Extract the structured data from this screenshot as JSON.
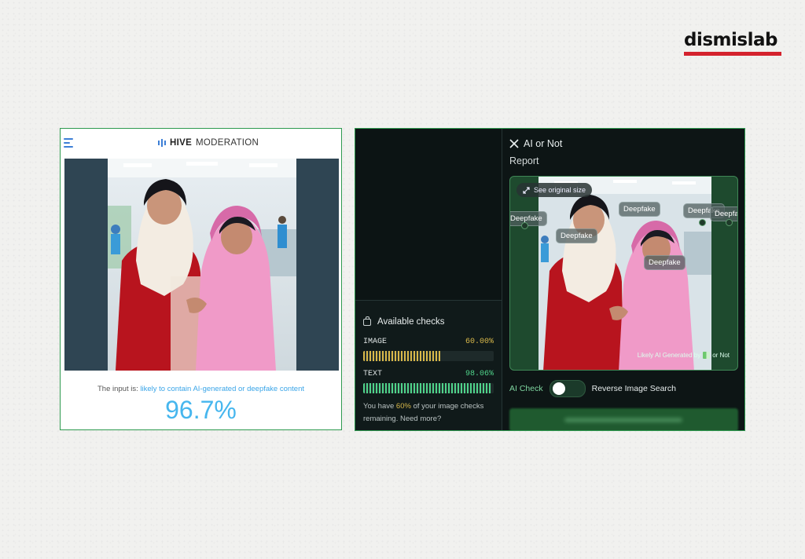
{
  "brand": {
    "name": "dismislab"
  },
  "hive": {
    "logo_bold": "HIVE",
    "logo_rest": "MODERATION",
    "result_prefix": "The input is:",
    "result_highlight": "likely to contain AI-generated or deepfake content",
    "score": "96.7%"
  },
  "aion": {
    "brand": "AI or Not",
    "report_title": "Report",
    "see_original": "See original size",
    "tags": [
      "Deepfake",
      "Deepfake",
      "Deepfake",
      "Deepfake",
      "Deepfake"
    ],
    "likely_prefix": "Likely AI Generated by",
    "likely_suffix": "or Not",
    "toggle_left": "AI Check",
    "toggle_right": "Reverse Image Search",
    "available_title": "Available checks",
    "meters": [
      {
        "label": "IMAGE",
        "percent_text": "60.00%",
        "fraction": 0.6,
        "color": "#d8b84a"
      },
      {
        "label": "TEXT",
        "percent_text": "98.06%",
        "fraction": 0.9806,
        "color": "#4fd38a"
      }
    ],
    "remaining_prefix": "You have",
    "remaining_pct": "60%",
    "remaining_suffix": "of your image checks remaining. Need more?"
  },
  "colors": {
    "hive_accent": "#46b6ee",
    "aion_bg": "#0d1515",
    "frame_border": "#2e9a4f",
    "brand_red": "#d4222d"
  },
  "icons": [
    "menu-icon",
    "hive-logo-icon",
    "aion-logo-icon",
    "expand-icon",
    "wallet-icon"
  ]
}
